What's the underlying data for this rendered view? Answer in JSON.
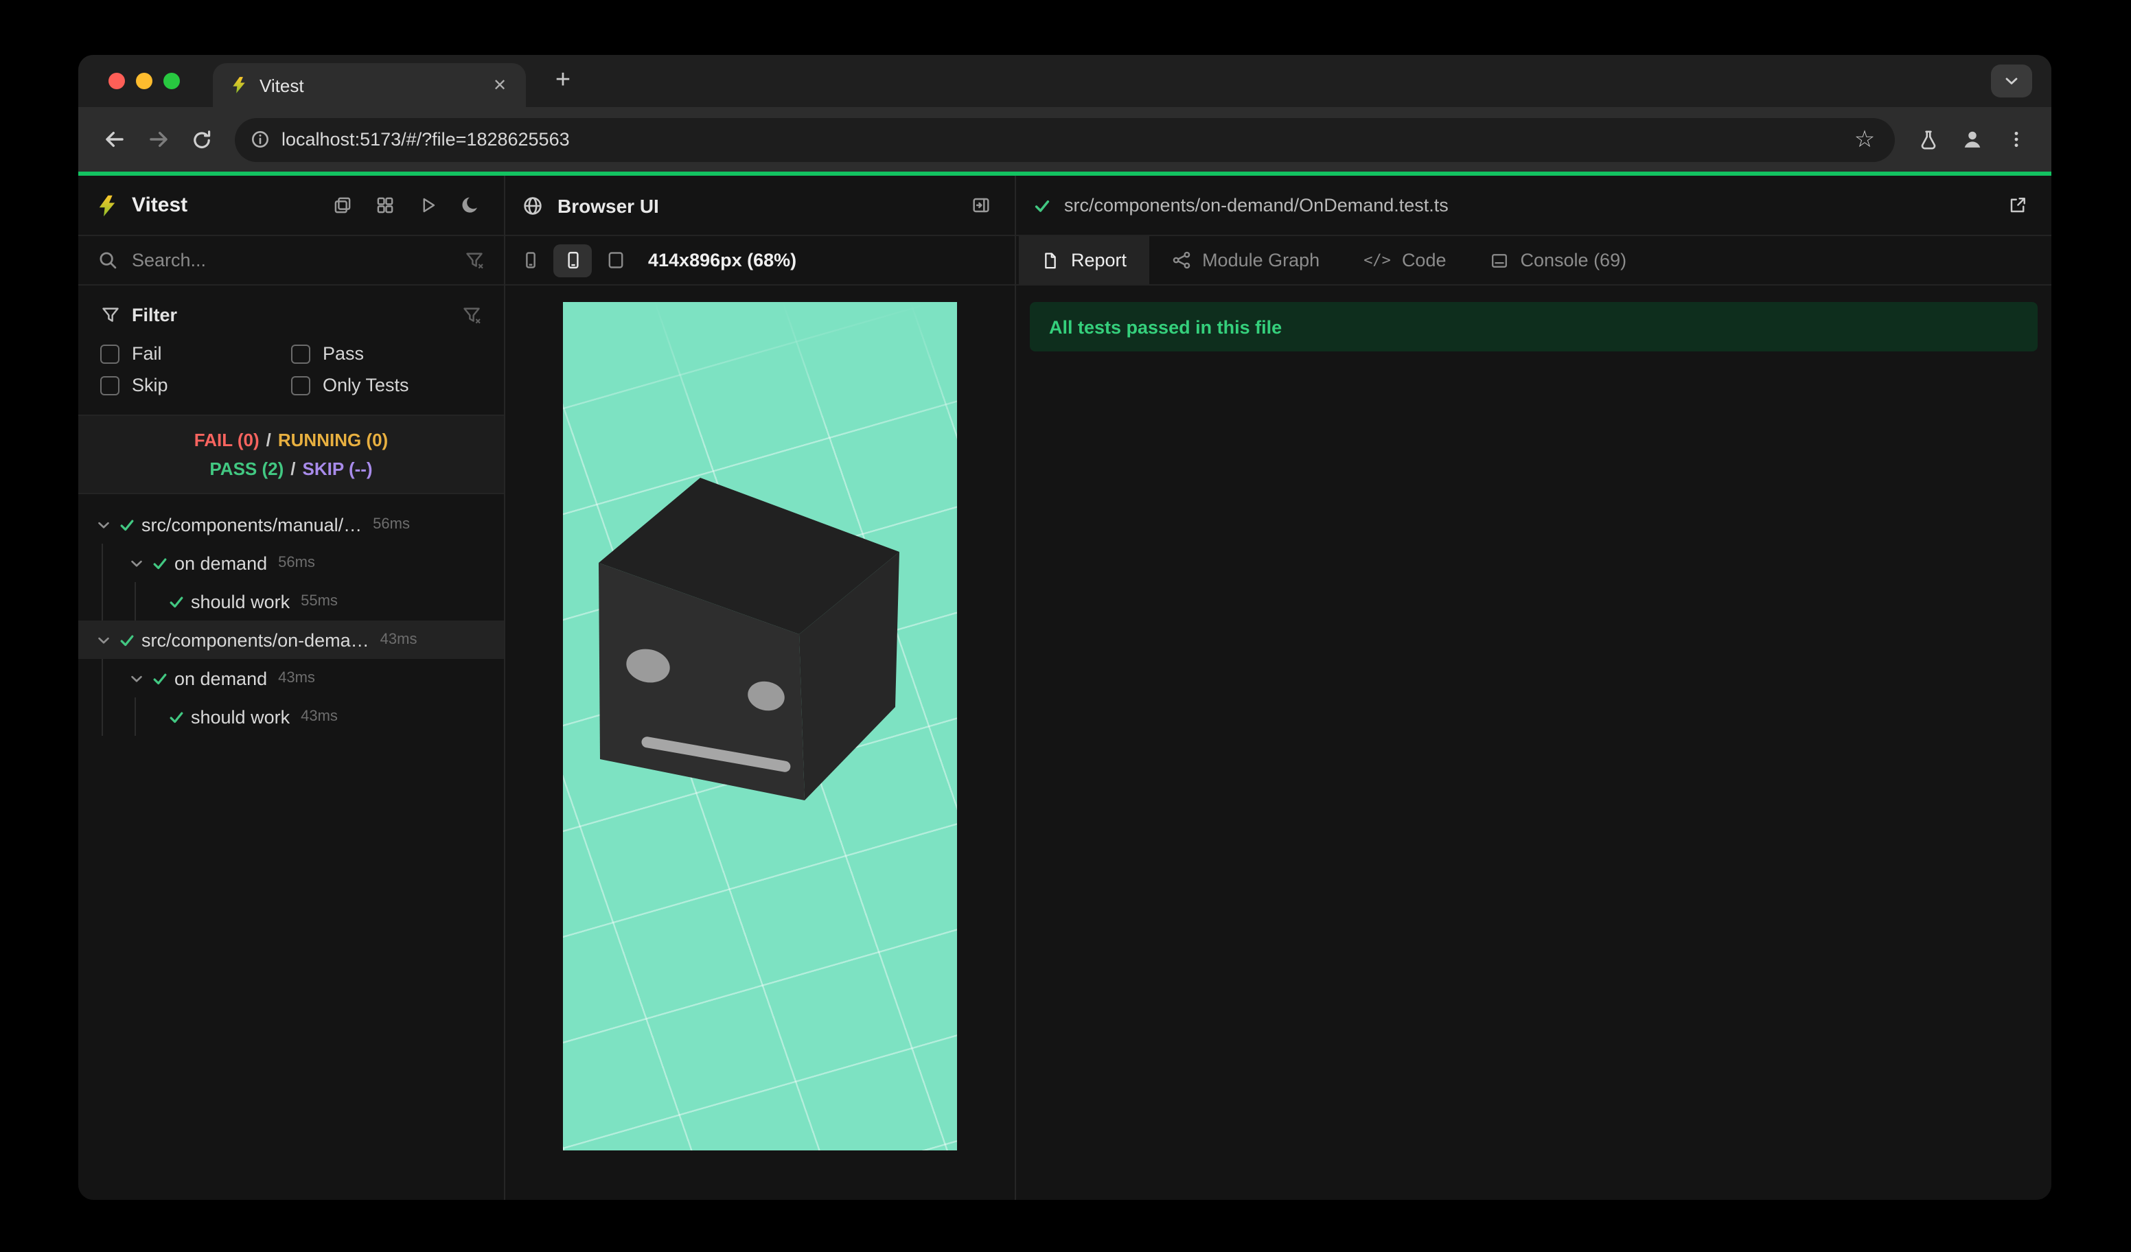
{
  "glyphs": {
    "close_tab": "✕",
    "new_tab": "+",
    "star": "☆",
    "code_tab": "</>"
  },
  "browser": {
    "tab_title": "Vitest",
    "url": "localhost:5173/#/?file=1828625563"
  },
  "sidebar": {
    "app_title": "Vitest",
    "search_placeholder": "Search...",
    "filter": {
      "title": "Filter",
      "options": [
        "Fail",
        "Pass",
        "Skip",
        "Only Tests"
      ]
    },
    "status": {
      "fail": "FAIL (0)",
      "running": "RUNNING (0)",
      "pass": "PASS (2)",
      "skip": "SKIP (--)",
      "sep": "/"
    },
    "tree": [
      {
        "label": "src/components/manual/…",
        "duration": "56ms"
      },
      {
        "label": "on demand",
        "duration": "56ms"
      },
      {
        "label": "should work",
        "duration": "55ms"
      },
      {
        "label": "src/components/on-dema…",
        "duration": "43ms"
      },
      {
        "label": "on demand",
        "duration": "43ms"
      },
      {
        "label": "should work",
        "duration": "43ms"
      }
    ]
  },
  "preview": {
    "title": "Browser UI",
    "size_label": "414x896px (68%)"
  },
  "results": {
    "file_path": "src/components/on-demand/OnDemand.test.ts",
    "tabs": [
      {
        "label": "Report"
      },
      {
        "label": "Module Graph"
      },
      {
        "label": "Code"
      },
      {
        "label": "Console (69)"
      }
    ],
    "banner": "All tests passed in this file"
  },
  "colors": {
    "accent_green": "#13c361",
    "viewport_teal": "#7de2c2",
    "pass": "#42c882",
    "fail": "#f8645f",
    "running": "#e8b040",
    "skip": "#a88bea"
  }
}
